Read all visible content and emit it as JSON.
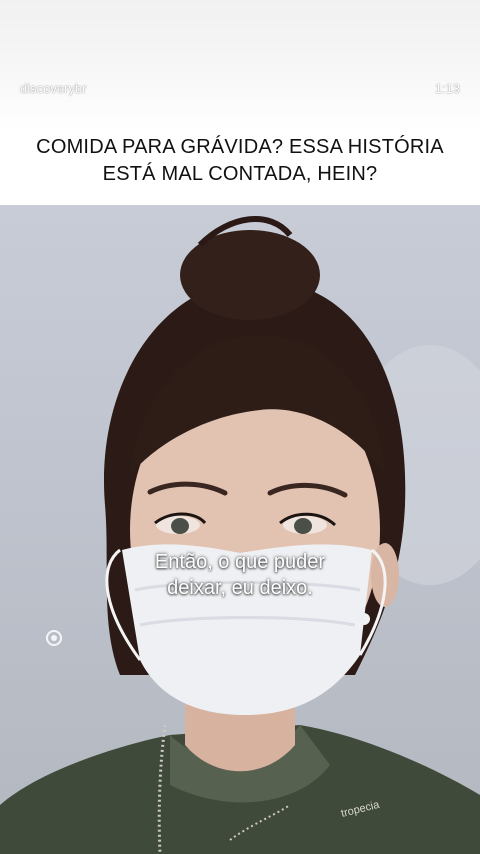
{
  "story": {
    "account_name": "discoverybr",
    "timestamp": "1:13",
    "title_lines": [
      "COMIDA PARA GRÁVIDA? ESSA HISTÓRIA",
      "ESTÁ MAL CONTADA, HEIN?"
    ]
  },
  "video": {
    "subtitle_lines": [
      "Então, o que puder",
      "deixar, eu deixo."
    ],
    "watermark_icon": "discovery-logo-icon",
    "scrub_text": "tropecia"
  },
  "colors": {
    "title_text": "#111111",
    "header_bg": "#f6f6f6",
    "video_bg": "#c4c8d1"
  }
}
